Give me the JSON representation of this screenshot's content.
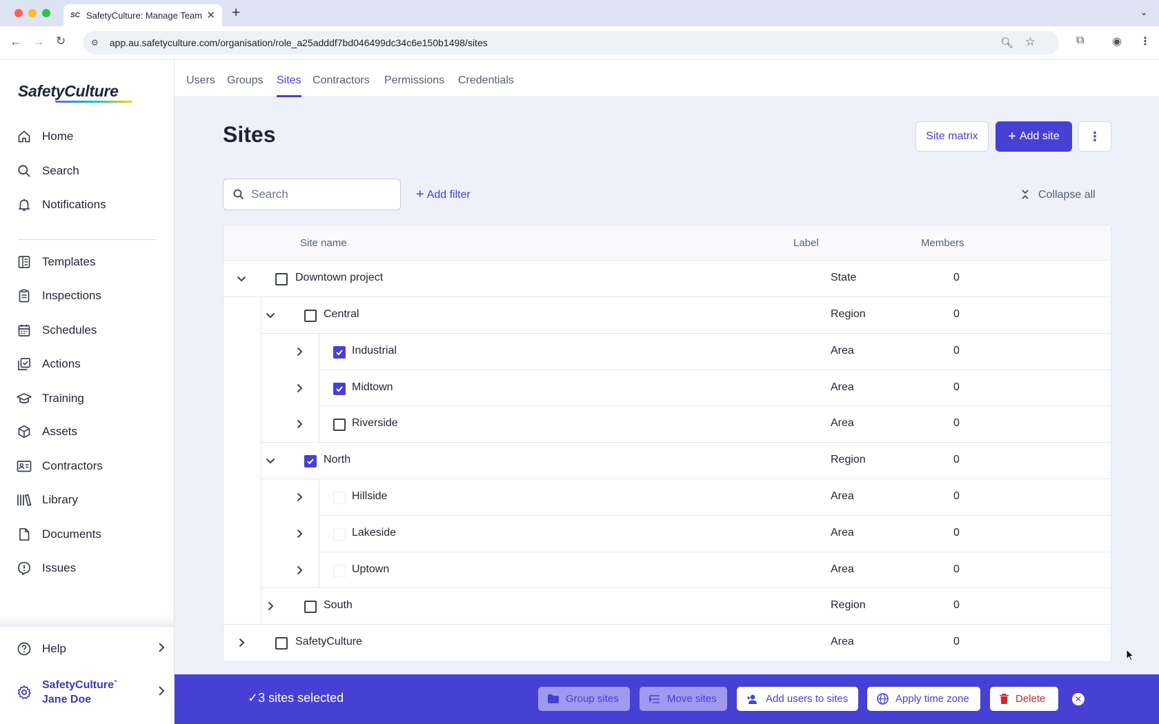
{
  "browser": {
    "tab_title": "SafetyCulture: Manage Teams",
    "favicon_text": "SC",
    "url": "app.au.safetyculture.com/organisation/role_a25adddf7bd046499dc34c6e150b1498/sites"
  },
  "sidebar": {
    "logo": "SafetyCulture",
    "primary_items": [
      {
        "label": "Home",
        "icon": "home-icon"
      },
      {
        "label": "Search",
        "icon": "search-icon"
      },
      {
        "label": "Notifications",
        "icon": "bell-icon"
      }
    ],
    "items": [
      {
        "label": "Templates",
        "icon": "templates-icon"
      },
      {
        "label": "Inspections",
        "icon": "clipboard-icon"
      },
      {
        "label": "Schedules",
        "icon": "calendar-icon"
      },
      {
        "label": "Actions",
        "icon": "actions-icon"
      },
      {
        "label": "Training",
        "icon": "graduation-cap-icon"
      },
      {
        "label": "Assets",
        "icon": "cube-icon"
      },
      {
        "label": "Contractors",
        "icon": "id-card-icon"
      },
      {
        "label": "Library",
        "icon": "library-icon"
      },
      {
        "label": "Documents",
        "icon": "document-icon"
      },
      {
        "label": "Issues",
        "icon": "issue-icon"
      }
    ],
    "help": "Help",
    "org_name": "SafetyCulture`",
    "user_name": "Jane Doe"
  },
  "topnav": {
    "items": [
      "Users",
      "Groups",
      "Sites",
      "Contractors",
      "Permissions",
      "Credentials"
    ],
    "active": "Sites"
  },
  "page": {
    "title": "Sites",
    "site_matrix": "Site matrix",
    "add_site": "Add site",
    "search_placeholder": "Search",
    "add_filter": "Add filter",
    "collapse_all": "Collapse all"
  },
  "table": {
    "columns": [
      "Site name",
      "Label",
      "Members"
    ],
    "rows": [
      {
        "name": "Downtown project",
        "label": "State",
        "members": "0",
        "level": 0,
        "expanded": true,
        "checked": false,
        "dim": false
      },
      {
        "name": "Central",
        "label": "Region",
        "members": "0",
        "level": 1,
        "expanded": true,
        "checked": false,
        "dim": false
      },
      {
        "name": "Industrial",
        "label": "Area",
        "members": "0",
        "level": 2,
        "expanded": false,
        "checked": true,
        "dim": false
      },
      {
        "name": "Midtown",
        "label": "Area",
        "members": "0",
        "level": 2,
        "expanded": false,
        "checked": true,
        "dim": false
      },
      {
        "name": "Riverside",
        "label": "Area",
        "members": "0",
        "level": 2,
        "expanded": false,
        "checked": false,
        "dim": false
      },
      {
        "name": "North",
        "label": "Region",
        "members": "0",
        "level": 1,
        "expanded": true,
        "checked": true,
        "dim": false
      },
      {
        "name": "Hillside",
        "label": "Area",
        "members": "0",
        "level": 2,
        "expanded": false,
        "checked": false,
        "dim": true
      },
      {
        "name": "Lakeside",
        "label": "Area",
        "members": "0",
        "level": 2,
        "expanded": false,
        "checked": false,
        "dim": true
      },
      {
        "name": "Uptown",
        "label": "Area",
        "members": "0",
        "level": 2,
        "expanded": false,
        "checked": false,
        "dim": true
      },
      {
        "name": "South",
        "label": "Region",
        "members": "0",
        "level": 1,
        "expanded": false,
        "checked": false,
        "dim": false
      },
      {
        "name": "SafetyCulture",
        "label": "Area",
        "members": "0",
        "level": 0,
        "expanded": false,
        "checked": false,
        "dim": false
      }
    ]
  },
  "selection_bar": {
    "count_text": "3 sites selected",
    "group_sites": "Group sites",
    "move_sites": "Move sites",
    "add_users": "Add users to sites",
    "apply_tz": "Apply time zone",
    "delete": "Delete"
  },
  "colors": {
    "accent": "#4740d4",
    "danger": "#d1242f",
    "background": "#eef0fa"
  }
}
